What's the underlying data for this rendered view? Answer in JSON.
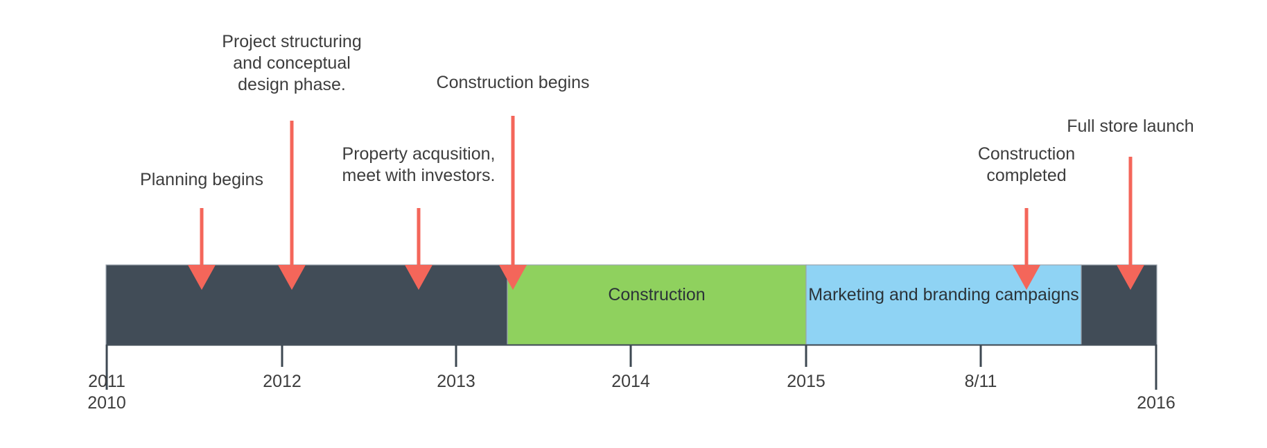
{
  "chart_data": {
    "type": "timeline",
    "title": "",
    "xlabel": "",
    "ylabel": "",
    "axis": {
      "start": 2010,
      "end": 2016,
      "tick_labels": [
        "2011",
        "2012",
        "2013",
        "2014",
        "2015",
        "8/11",
        "2016"
      ],
      "extra_labels": [
        "2010"
      ],
      "grid": false,
      "axis_color": "#3d4852"
    },
    "phases": [
      {
        "name": "",
        "label": "",
        "color": "#414c57",
        "start": 2010.0,
        "end": 2012.3
      },
      {
        "name": "construction",
        "label": "Construction",
        "color": "#8fd15e",
        "start": 2012.3,
        "end": 2014.0
      },
      {
        "name": "marketing",
        "label": "Marketing and branding campaigns",
        "color": "#8fd3f4",
        "start": 2014.0,
        "end": 2015.58
      },
      {
        "name": "",
        "label": "",
        "color": "#414c57",
        "start": 2015.58,
        "end": 2016.0
      }
    ],
    "milestones": [
      {
        "label": "Planning begins",
        "at": 2010.55,
        "lines": [
          "Planning begins"
        ]
      },
      {
        "label": "Project structuring and conceptual design phase.",
        "at": 2011.07,
        "lines": [
          "Project structuring",
          "and conceptual",
          "design phase."
        ]
      },
      {
        "label": "Property acqusition, meet with investors.",
        "at": 2011.79,
        "lines": [
          "Property acqusition,",
          "meet with investors."
        ]
      },
      {
        "label": "Construction begins",
        "at": 2012.33,
        "lines": [
          "Construction begins"
        ]
      },
      {
        "label": "Construction completed",
        "at": 2015.27,
        "lines": [
          "Construction",
          "completed"
        ]
      },
      {
        "label": "Full store launch",
        "at": 2015.86,
        "lines": [
          "Full store launch"
        ]
      }
    ],
    "colors": {
      "marker": "#f4665a",
      "dark_bar": "#414c57",
      "green_bar": "#8fd15e",
      "blue_bar": "#8fd3f4",
      "text": "#3d3d3d",
      "background": "#ffffff"
    }
  },
  "annotations": {
    "planning_begins": "Planning begins",
    "project_structuring_l1": "Project structuring",
    "project_structuring_l2": "and conceptual",
    "project_structuring_l3": "design phase.",
    "property_l1": "Property acqusition,",
    "property_l2": "meet with investors.",
    "construction_begins": "Construction begins",
    "construction_completed_l1": "Construction",
    "construction_completed_l2": "completed",
    "full_store_launch": "Full store launch"
  },
  "segment_labels": {
    "construction": "Construction",
    "marketing": "Marketing and branding campaigns"
  },
  "ticks": {
    "t2011": "2011",
    "t2010": "2010",
    "t2012": "2012",
    "t2013": "2013",
    "t2014": "2014",
    "t2015": "2015",
    "t811": "8/11",
    "t2016": "2016"
  }
}
